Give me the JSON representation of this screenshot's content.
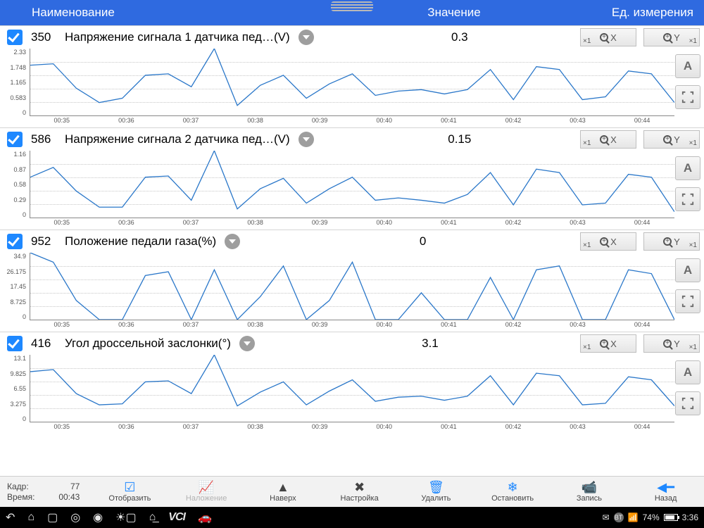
{
  "header": {
    "name": "Наименование",
    "value": "Значение",
    "unit": "Ед. измерения"
  },
  "zoom": {
    "x1": "×1",
    "x": "X",
    "y": "Y"
  },
  "side": {
    "auto": "A"
  },
  "toolbar": {
    "frame_label": "Кадр:",
    "frame_val": "77",
    "time_label": "Время:",
    "time_val": "00:43",
    "show": "Отобразить",
    "overlay": "Наложение",
    "top": "Наверх",
    "settings": "Настройка",
    "delete": "Удалить",
    "stop": "Остановить",
    "record": "Запись",
    "back": "Назад"
  },
  "status": {
    "bt": "BT",
    "batt_pct": "74%",
    "clock": "3:36"
  },
  "x_ticks": [
    "00:35",
    "00:36",
    "00:37",
    "00:38",
    "00:39",
    "00:40",
    "00:41",
    "00:42",
    "00:43",
    "00:44"
  ],
  "params": [
    {
      "id": "350",
      "name": "Напряжение сигнала 1 датчика пед…(V)",
      "value": "0.3",
      "y_ticks": [
        "2.33",
        "1.748",
        "1.165",
        "0.583",
        "0"
      ]
    },
    {
      "id": "586",
      "name": "Напряжение сигнала 2 датчика пед…(V)",
      "value": "0.15",
      "y_ticks": [
        "1.16",
        "0.87",
        "0.58",
        "0.29",
        "0"
      ]
    },
    {
      "id": "952",
      "name": "Положение педали газа(%)",
      "value": "0",
      "y_ticks": [
        "34.9",
        "26.175",
        "17.45",
        "8.725",
        "0"
      ]
    },
    {
      "id": "416",
      "name": "Угол дроссельной заслонки(°)",
      "value": "3.1",
      "y_ticks": [
        "13.1",
        "9.825",
        "6.55",
        "3.275",
        "0"
      ]
    }
  ],
  "chart_data": [
    {
      "type": "line",
      "title": "Напряжение сигнала 1 датчика пед…(V)",
      "x": [
        "00:34.5",
        "00:35",
        "00:35.3",
        "00:35.7",
        "00:36",
        "00:36.3",
        "00:36.7",
        "00:37",
        "00:37.3",
        "00:37.7",
        "00:38",
        "00:38.3",
        "00:38.7",
        "00:39",
        "00:39.3",
        "00:39.7",
        "00:40",
        "00:40.3",
        "00:40.7",
        "00:41",
        "00:41.3",
        "00:41.7",
        "00:42",
        "00:42.3",
        "00:42.7",
        "00:43",
        "00:43.3",
        "00:43.7",
        "00:44"
      ],
      "values": [
        1.75,
        1.8,
        0.95,
        0.45,
        0.6,
        1.4,
        1.45,
        1.0,
        2.33,
        0.35,
        1.05,
        1.4,
        0.6,
        1.1,
        1.45,
        0.7,
        0.85,
        0.9,
        0.75,
        0.9,
        1.6,
        0.55,
        1.7,
        1.6,
        0.55,
        0.65,
        1.55,
        1.45,
        0.45
      ],
      "ylim": [
        0,
        2.33
      ],
      "xlabel": "",
      "ylabel": ""
    },
    {
      "type": "line",
      "title": "Напряжение сигнала 2 датчика пед…(V)",
      "x": [
        "00:34.5",
        "00:35",
        "00:35.3",
        "00:35.7",
        "00:36",
        "00:36.3",
        "00:36.7",
        "00:37",
        "00:37.3",
        "00:37.7",
        "00:38",
        "00:38.3",
        "00:38.7",
        "00:39",
        "00:39.3",
        "00:39.7",
        "00:40",
        "00:40.3",
        "00:40.7",
        "00:41",
        "00:41.3",
        "00:41.7",
        "00:42",
        "00:42.3",
        "00:42.7",
        "00:43",
        "00:43.3",
        "00:43.7",
        "00:44"
      ],
      "values": [
        0.7,
        0.87,
        0.46,
        0.18,
        0.18,
        0.7,
        0.72,
        0.3,
        1.16,
        0.15,
        0.5,
        0.68,
        0.25,
        0.5,
        0.7,
        0.3,
        0.34,
        0.3,
        0.25,
        0.4,
        0.78,
        0.22,
        0.84,
        0.78,
        0.22,
        0.25,
        0.75,
        0.7,
        0.1
      ],
      "ylim": [
        0,
        1.16
      ],
      "xlabel": "",
      "ylabel": ""
    },
    {
      "type": "line",
      "title": "Положение педали газа(%)",
      "x": [
        "00:34.5",
        "00:35",
        "00:35.3",
        "00:35.7",
        "00:36",
        "00:36.3",
        "00:36.7",
        "00:37",
        "00:37.3",
        "00:37.7",
        "00:38",
        "00:38.3",
        "00:38.7",
        "00:39",
        "00:39.3",
        "00:39.7",
        "00:40",
        "00:40.3",
        "00:40.7",
        "00:41",
        "00:41.3",
        "00:41.7",
        "00:42",
        "00:42.3",
        "00:42.7",
        "00:43",
        "00:43.3",
        "00:43.7",
        "00:44"
      ],
      "values": [
        34.9,
        30,
        10,
        0,
        0,
        23,
        25,
        0,
        26,
        0,
        12,
        28,
        0,
        10,
        30,
        0,
        0,
        14,
        0,
        0,
        22,
        0,
        26,
        28,
        0,
        0,
        26,
        24,
        0
      ],
      "ylim": [
        0,
        34.9
      ],
      "xlabel": "",
      "ylabel": ""
    },
    {
      "type": "line",
      "title": "Угол дроссельной заслонки(°)",
      "x": [
        "00:34.5",
        "00:35",
        "00:35.3",
        "00:35.7",
        "00:36",
        "00:36.3",
        "00:36.7",
        "00:37",
        "00:37.3",
        "00:37.7",
        "00:38",
        "00:38.3",
        "00:38.7",
        "00:39",
        "00:39.3",
        "00:39.7",
        "00:40",
        "00:40.3",
        "00:40.7",
        "00:41",
        "00:41.3",
        "00:41.7",
        "00:42",
        "00:42.3",
        "00:42.7",
        "00:43",
        "00:43.3",
        "00:43.7",
        "00:44"
      ],
      "values": [
        9.8,
        10.2,
        5.5,
        3.3,
        3.5,
        7.8,
        8.0,
        5.5,
        13.1,
        3.1,
        5.8,
        7.8,
        3.3,
        6.0,
        8.2,
        4.0,
        4.8,
        5.0,
        4.2,
        5.0,
        9.0,
        3.3,
        9.5,
        9.0,
        3.3,
        3.6,
        8.8,
        8.2,
        3.1
      ],
      "ylim": [
        0,
        13.1
      ],
      "xlabel": "",
      "ylabel": ""
    }
  ]
}
